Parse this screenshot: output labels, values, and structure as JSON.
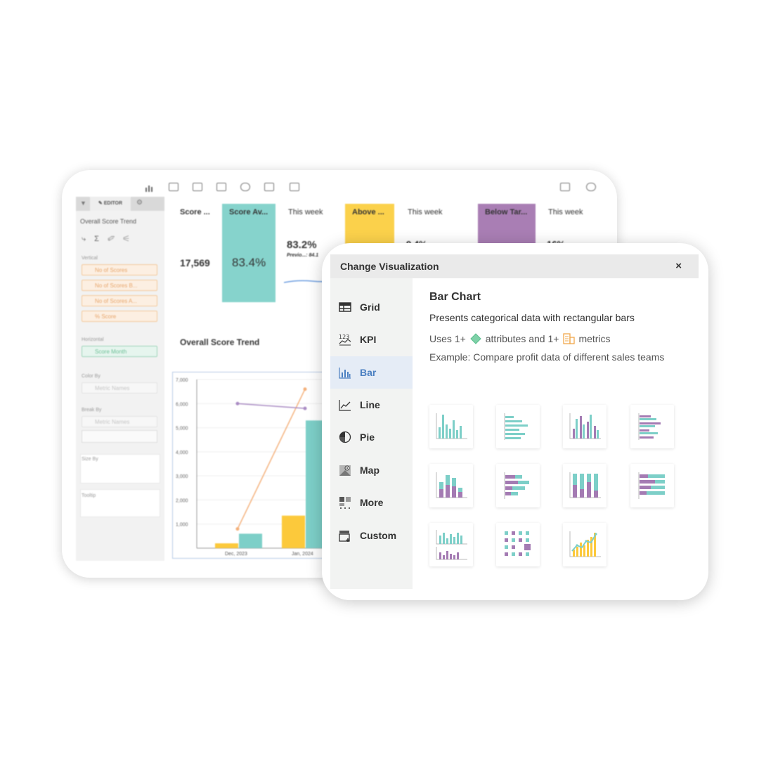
{
  "dashboard": {
    "editor": {
      "tab_label": "EDITOR",
      "widget_title": "Overall Score Trend",
      "sections": {
        "vertical": "Vertical",
        "horizontal": "Horizontal",
        "color_by": "Color By",
        "break_by": "Break By",
        "size_by": "Size By",
        "tooltip": "Tooltip"
      },
      "vertical_fields": [
        "No of Scores",
        "No of Scores B...",
        "No of Scores A...",
        "% Score"
      ],
      "horizontal_field": "Score Month",
      "color_by_field": "Metric Names",
      "break_by_field": "Metric Names"
    },
    "kpis": [
      {
        "label": "Score ...",
        "value": "17,569"
      },
      {
        "label": "Score Av...",
        "value": "83.4%",
        "color": "#86d3cc"
      },
      {
        "label": "This week",
        "value": "83.2%",
        "sub": "Previo...: 84.1"
      },
      {
        "label": "Above ...",
        "color": "#fbd14b"
      },
      {
        "label": "This week",
        "value": "9.4%"
      },
      {
        "label": "Below Tar...",
        "color": "#a97eb4"
      },
      {
        "label": "This week",
        "value": "16%"
      }
    ],
    "chart_title": "Overall Score Trend",
    "chart_data": {
      "type": "bar",
      "categories": [
        "Dec, 2023",
        "Jan, 2024"
      ],
      "ylim": [
        0,
        7000
      ],
      "yticks": [
        "7,000",
        "6,000",
        "5,000",
        "4,000",
        "3,000",
        "2,000",
        "1,000"
      ],
      "series": [
        {
          "values": [
            200,
            1350
          ],
          "color": "#fcc93b"
        },
        {
          "values": [
            600,
            5300
          ],
          "color": "#7dcfc8"
        }
      ],
      "lines": [
        {
          "values": [
            800,
            6600
          ],
          "color": "#f4b07a"
        },
        {
          "values": [
            6000,
            5800
          ],
          "color": "#a98bc3"
        }
      ]
    }
  },
  "modal": {
    "title": "Change Visualization",
    "close_label": "×",
    "nav": [
      {
        "label": "Grid",
        "icon": "grid-icon"
      },
      {
        "label": "KPI",
        "icon": "kpi-icon"
      },
      {
        "label": "Bar",
        "icon": "bar-chart-icon",
        "active": true
      },
      {
        "label": "Line",
        "icon": "line-chart-icon"
      },
      {
        "label": "Pie",
        "icon": "pie-chart-icon"
      },
      {
        "label": "Map",
        "icon": "map-icon"
      },
      {
        "label": "More",
        "icon": "more-icon"
      },
      {
        "label": "Custom",
        "icon": "custom-icon"
      }
    ],
    "detail": {
      "title": "Bar Chart",
      "description": "Presents categorical data with rectangular bars",
      "uses_prefix": "Uses 1+",
      "uses_attributes": "attributes and 1+",
      "uses_metrics": "metrics",
      "example": "Example: Compare profit data of different sales teams"
    },
    "thumbnails": [
      "column-chart",
      "horizontal-bar-chart",
      "grouped-column-chart",
      "grouped-bar-chart",
      "stacked-column-chart",
      "stacked-bar-chart",
      "100-stacked-column-chart",
      "100-stacked-bar-chart",
      "small-multiples-chart",
      "dot-matrix-chart",
      "combo-bar-line-chart"
    ],
    "colors": {
      "teal": "#7dcfc8",
      "purple": "#a47bb3",
      "yellow": "#fcc93b",
      "accent": "#4a7fc1"
    }
  }
}
